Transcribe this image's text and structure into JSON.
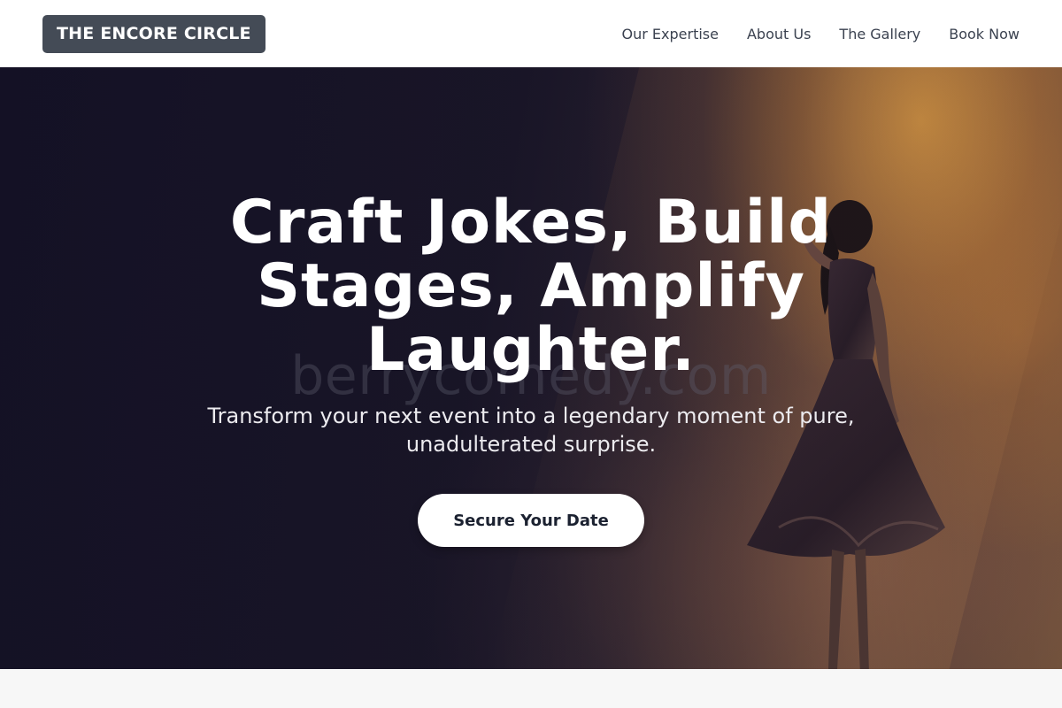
{
  "header": {
    "logo": "THE ENCORE CIRCLE",
    "nav": [
      {
        "label": "Our Expertise"
      },
      {
        "label": "About Us"
      },
      {
        "label": "The Gallery"
      },
      {
        "label": "Book Now"
      }
    ]
  },
  "hero": {
    "title": "Craft Jokes, Build Stages, Amplify Laughter.",
    "subtitle": "Transform your next event into a legendary moment of pure, unadulterated surprise.",
    "cta_label": "Secure Your Date",
    "watermark": "berrycomedy.com"
  },
  "colors": {
    "logo_bg": "#444b56",
    "nav_text": "#3b4250",
    "hero_dark": "#17142a",
    "stage_light": "#d6963e",
    "cta_bg": "#ffffff",
    "cta_text": "#1b2130"
  }
}
